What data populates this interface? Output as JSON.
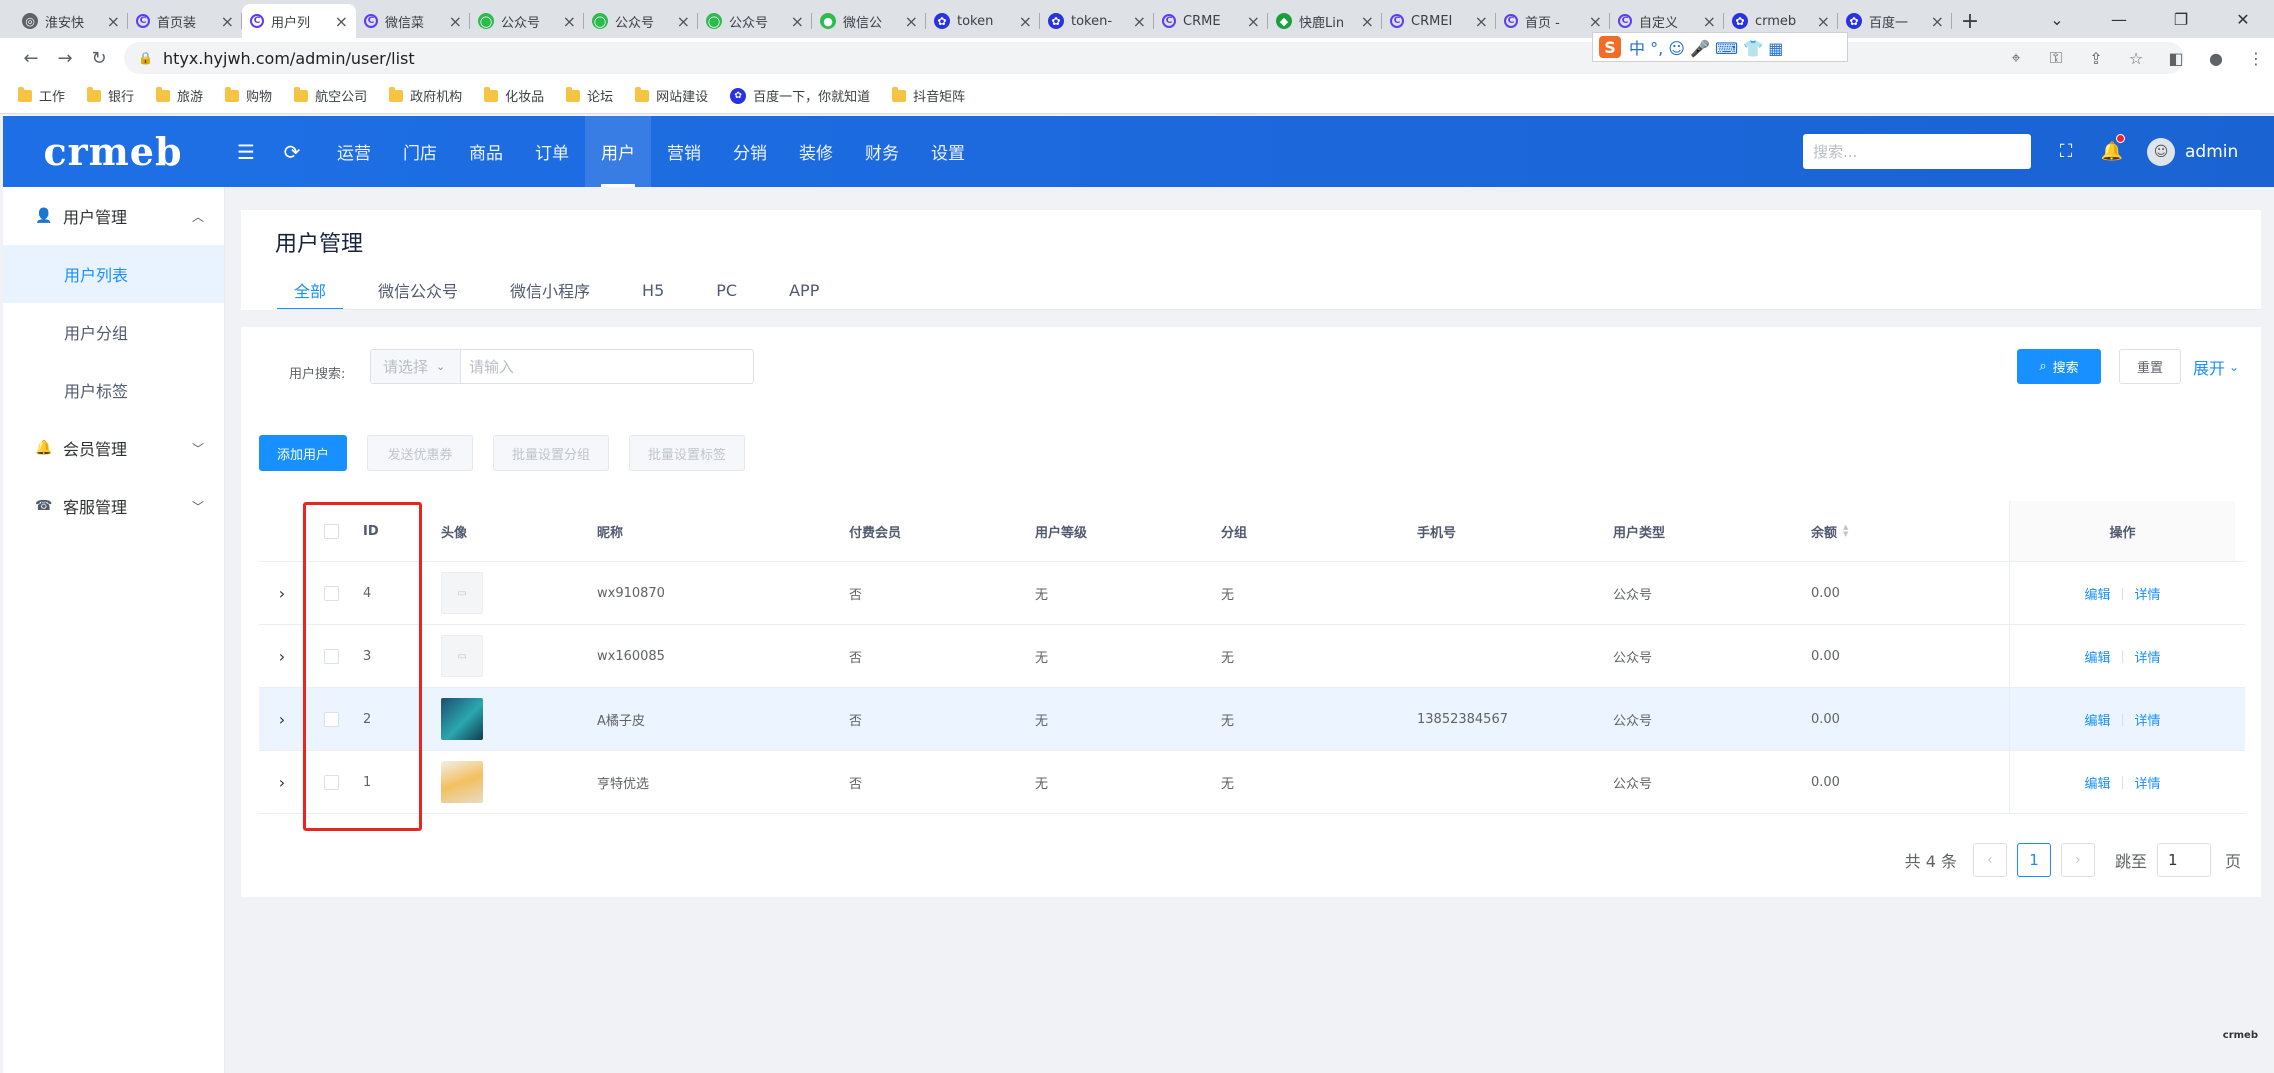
{
  "browser": {
    "tabs": [
      {
        "label": "淮安快",
        "active": false,
        "color": "#5f6368",
        "glyph": "◎"
      },
      {
        "label": "首页装",
        "active": false,
        "color": "#5b3df5",
        "glyph": "C"
      },
      {
        "label": "用户列",
        "active": true,
        "color": "#5b3df5",
        "glyph": "C"
      },
      {
        "label": "微信菜",
        "active": false,
        "color": "#5b3df5",
        "glyph": "C"
      },
      {
        "label": "公众号",
        "active": false,
        "color": "#2dbb4e",
        "glyph": "◯"
      },
      {
        "label": "公众号",
        "active": false,
        "color": "#2dbb4e",
        "glyph": "◯"
      },
      {
        "label": "公众号",
        "active": false,
        "color": "#2dbb4e",
        "glyph": "◯"
      },
      {
        "label": "微信公",
        "active": false,
        "color": "#2dbb4e",
        "glyph": "●"
      },
      {
        "label": "token",
        "active": false,
        "color": "#2932e1",
        "glyph": "✿"
      },
      {
        "label": "token-",
        "active": false,
        "color": "#2932e1",
        "glyph": "✿"
      },
      {
        "label": "CRME",
        "active": false,
        "color": "#5b3df5",
        "glyph": "C"
      },
      {
        "label": "快鹿Lin",
        "active": false,
        "color": "#1a9f3c",
        "glyph": "◆"
      },
      {
        "label": "CRMEI",
        "active": false,
        "color": "#5b3df5",
        "glyph": "C"
      },
      {
        "label": "首页 -",
        "active": false,
        "color": "#5b3df5",
        "glyph": "C"
      },
      {
        "label": "自定义",
        "active": false,
        "color": "#5b3df5",
        "glyph": "C"
      },
      {
        "label": "crmeb",
        "active": false,
        "color": "#2932e1",
        "glyph": "✿"
      },
      {
        "label": "百度一",
        "active": false,
        "color": "#2932e1",
        "glyph": "✿"
      }
    ],
    "url": "htyx.hyjwh.com/admin/user/list",
    "bookmarks": [
      {
        "label": "工作",
        "type": "folder"
      },
      {
        "label": "银行",
        "type": "folder"
      },
      {
        "label": "旅游",
        "type": "folder"
      },
      {
        "label": "购物",
        "type": "folder"
      },
      {
        "label": "航空公司",
        "type": "folder"
      },
      {
        "label": "政府机构",
        "type": "folder"
      },
      {
        "label": "化妆品",
        "type": "folder"
      },
      {
        "label": "论坛",
        "type": "folder"
      },
      {
        "label": "网站建设",
        "type": "folder"
      },
      {
        "label": "百度一下，你就知道",
        "type": "site"
      },
      {
        "label": "抖音矩阵",
        "type": "folder"
      }
    ],
    "ime": {
      "badge": "S",
      "text": "中 °, ☺ 🎤 ⌨ 👕 ▦"
    }
  },
  "header": {
    "logo": "crmeb",
    "nav": [
      {
        "label": "运营",
        "active": false
      },
      {
        "label": "门店",
        "active": false
      },
      {
        "label": "商品",
        "active": false
      },
      {
        "label": "订单",
        "active": false
      },
      {
        "label": "用户",
        "active": true
      },
      {
        "label": "营销",
        "active": false
      },
      {
        "label": "分销",
        "active": false
      },
      {
        "label": "装修",
        "active": false
      },
      {
        "label": "财务",
        "active": false
      },
      {
        "label": "设置",
        "active": false
      }
    ],
    "search_placeholder": "搜索...",
    "username": "admin"
  },
  "sidebar": {
    "groups": [
      {
        "label": "用户管理",
        "icon": "user-icon",
        "expanded": true,
        "items": [
          {
            "label": "用户列表",
            "active": true
          },
          {
            "label": "用户分组",
            "active": false
          },
          {
            "label": "用户标签",
            "active": false
          }
        ]
      },
      {
        "label": "会员管理",
        "icon": "member-icon",
        "expanded": false,
        "items": []
      },
      {
        "label": "客服管理",
        "icon": "service-icon",
        "expanded": false,
        "items": []
      }
    ]
  },
  "page": {
    "title": "用户管理",
    "tabs": [
      {
        "label": "全部",
        "active": true
      },
      {
        "label": "微信公众号",
        "active": false
      },
      {
        "label": "微信小程序",
        "active": false
      },
      {
        "label": "H5",
        "active": false
      },
      {
        "label": "PC",
        "active": false
      },
      {
        "label": "APP",
        "active": false
      }
    ]
  },
  "filter": {
    "label": "用户搜索:",
    "select_placeholder": "请选择",
    "input_placeholder": "请输入",
    "search_button": "搜索",
    "reset_button": "重置",
    "expand": "展开"
  },
  "actions": {
    "add_user": "添加用户",
    "send_coupon": "发送优惠券",
    "batch_group": "批量设置分组",
    "batch_label": "批量设置标签"
  },
  "table": {
    "columns": {
      "id": "ID",
      "avatar": "头像",
      "nickname": "昵称",
      "vip": "付费会员",
      "level": "用户等级",
      "group": "分组",
      "phone": "手机号",
      "type": "用户类型",
      "balance": "余额",
      "ops": "操作"
    },
    "rows": [
      {
        "id": "4",
        "avatar": "placeholder",
        "nickname": "wx910870",
        "vip": "否",
        "level": "无",
        "group": "无",
        "phone": "",
        "type": "公众号",
        "balance": "0.00",
        "highlight": false
      },
      {
        "id": "3",
        "avatar": "placeholder",
        "nickname": "wx160085",
        "vip": "否",
        "level": "无",
        "group": "无",
        "phone": "",
        "type": "公众号",
        "balance": "0.00",
        "highlight": false
      },
      {
        "id": "2",
        "avatar": "photo-sea",
        "nickname": "A橘子皮",
        "vip": "否",
        "level": "无",
        "group": "无",
        "phone": "13852384567",
        "type": "公众号",
        "balance": "0.00",
        "highlight": true
      },
      {
        "id": "1",
        "avatar": "photo-product",
        "nickname": "亨特优选",
        "vip": "否",
        "level": "无",
        "group": "无",
        "phone": "",
        "type": "公众号",
        "balance": "0.00",
        "highlight": false
      }
    ],
    "op_edit": "编辑",
    "op_detail": "详情"
  },
  "pagination": {
    "total": "共 4 条",
    "current": "1",
    "jump_label": "跳至",
    "jump_value": "1",
    "page_suffix": "页"
  },
  "watermark": "crmeb",
  "colors": {
    "primary": "#1890ff",
    "header": "#1e6fe6",
    "annotation": "#e8261f"
  }
}
